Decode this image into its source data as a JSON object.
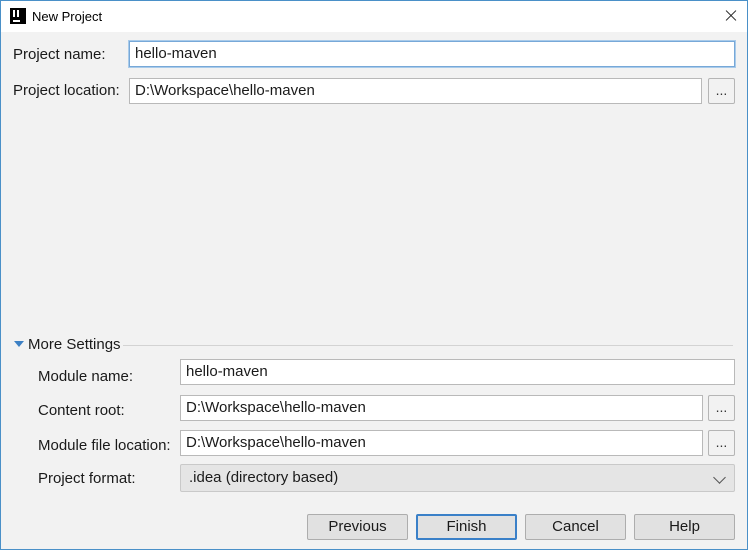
{
  "window": {
    "title": "New Project",
    "app_icon": "intellij-icon",
    "close_icon": "close-icon"
  },
  "project": {
    "name_label": "Project name:",
    "name_value": "hello-maven",
    "location_label": "Project location:",
    "location_value": "D:\\Workspace\\hello-maven",
    "browse_label": "..."
  },
  "more_settings": {
    "label": "More Settings",
    "expanded": true,
    "module_name_label": "Module name:",
    "module_name_value": "hello-maven",
    "content_root_label": "Content root:",
    "content_root_value": "D:\\Workspace\\hello-maven",
    "module_file_location_label": "Module file location:",
    "module_file_location_value": "D:\\Workspace\\hello-maven",
    "project_format_label": "Project format:",
    "project_format_value": ".idea (directory based)",
    "browse_label": "..."
  },
  "buttons": {
    "previous": "Previous",
    "finish": "Finish",
    "cancel": "Cancel",
    "help": "Help"
  },
  "colors": {
    "accent": "#3a80c8",
    "dialog_bg": "#f2f2f2"
  }
}
